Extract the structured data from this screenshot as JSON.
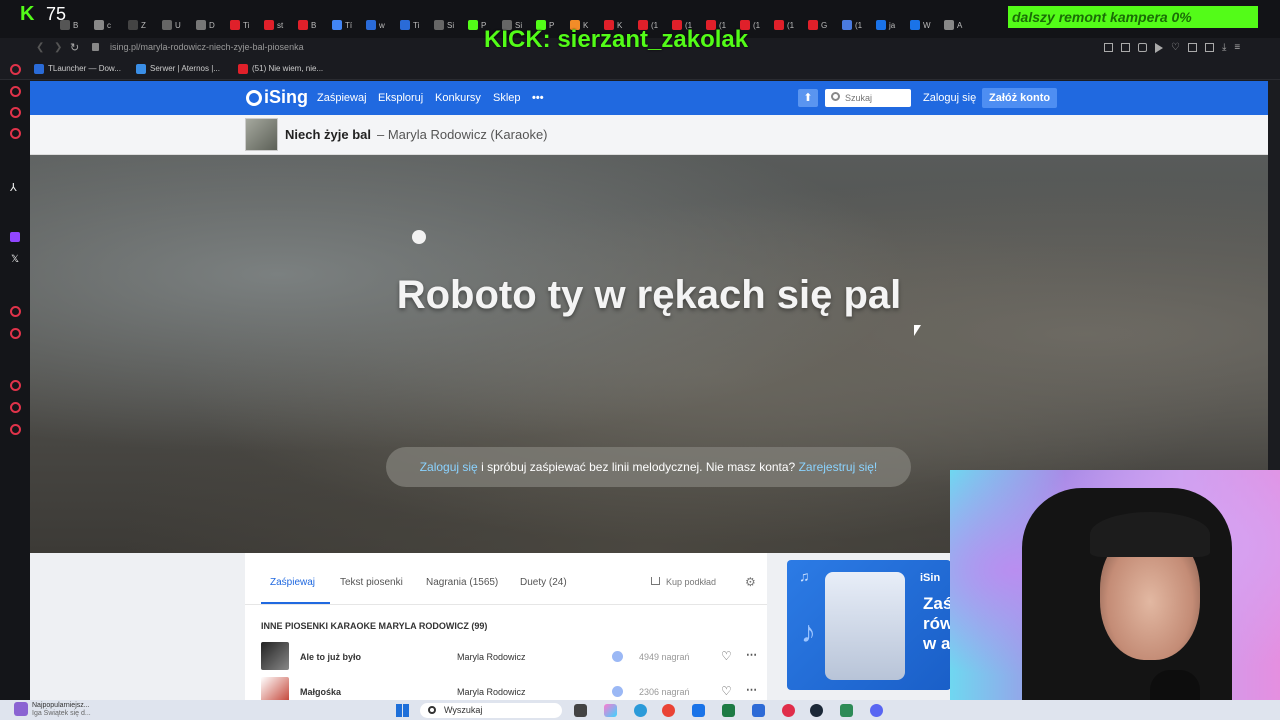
{
  "stream": {
    "kick_count": "75",
    "overlay_title": "KICK: sierzant_zakolak",
    "goal": "dalszy remont kampera 0%"
  },
  "browser": {
    "tabs": [
      "B",
      "c",
      "Z",
      "U",
      "D",
      "Ti",
      "st",
      "B",
      "Tí",
      "w",
      "Ti",
      "Si",
      "P",
      "Si",
      "P",
      "K",
      "K",
      "(1",
      "(1",
      "(1",
      "(1",
      "(1",
      "G",
      "(1",
      "ja",
      "W",
      "A"
    ],
    "url": "ising.pl/maryla-rodowicz-niech-zyje-bal-piosenka",
    "bookmarks": [
      "TLauncher — Dow...",
      "Serwer | Aternos |...",
      "(51) Nie wiem, nie..."
    ]
  },
  "site": {
    "logo": "iSing",
    "nav": [
      "Zaśpiewaj",
      "Eksploruj",
      "Konkursy",
      "Sklep"
    ],
    "more": "•••",
    "search_placeholder": "Szukaj",
    "login": "Zaloguj się",
    "register": "Załóż konto"
  },
  "song": {
    "title": "Niech żyje bal",
    "subtitle": "– Maryla Rodowicz (Karaoke)",
    "lyric": "Roboto ty w rękach się pal",
    "prompt_login": "Zaloguj się",
    "prompt_middle": "i spróbuj zaśpiewać bez linii melodycznej. Nie masz konta?",
    "prompt_register": "Zarejestruj się!"
  },
  "content": {
    "tabs": [
      "Zaśpiewaj",
      "Tekst piosenki",
      "Nagrania (1565)",
      "Duety (24)"
    ],
    "buy": "Kup podkład",
    "section_title": "INNE PIOSENKI KARAOKE MARYLA RODOWICZ (99)",
    "songs": [
      {
        "title": "Ale to już było",
        "artist": "Maryla Rodowicz",
        "recordings": "4949 nagrań"
      },
      {
        "title": "Małgośka",
        "artist": "Maryla Rodowicz",
        "recordings": "2306 nagrań"
      }
    ]
  },
  "ad": {
    "brand": "iSin",
    "line1": "Zaś",
    "line2": "rów",
    "line3": "w a"
  },
  "taskbar": {
    "notif_title": "Najpopularniejsz...",
    "notif_sub": "Iga Świątek się d...",
    "search": "Wyszukaj"
  }
}
